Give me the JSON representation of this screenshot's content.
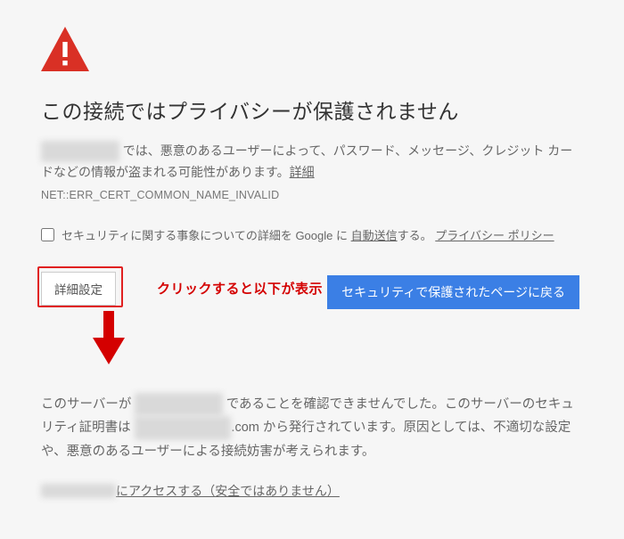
{
  "warningIcon": "triangle-exclamation",
  "title": "この接続ではプライバシーが保護されません",
  "bodyLine1_prefix": "",
  "bodyLine1_suffix": " では、悪意のあるユーザーによって、パスワード、メッセージ、クレジット カードなどの情報が盗まれる可能性があります。",
  "learnMore": "詳細",
  "errorCode": "NET::ERR_CERT_COMMON_NAME_INVALID",
  "optin_prefix": "セキュリティに関する事象についての詳細を Google に",
  "optin_link1": "自動送信",
  "optin_mid": "する。",
  "optin_link2": "プライバシー ポリシー",
  "advancedBtn": "詳細設定",
  "annotation": "クリックすると以下が表示",
  "backBtn": "セキュリティで保護されたページに戻る",
  "details_p1_a": "このサーバーが ",
  "details_p1_b": " であることを確認できませんでした。このサーバーのセキュリティ証明書は ",
  "details_p1_c": ".com から発行されています。原因としては、不適切な設定や、悪意のあるユーザーによる接続妨害が考えられます。",
  "proceed_mid": "にアクセスする（安全ではありません）",
  "redact_dom1": "xxx xxxxxxxxx",
  "redact_dom2": "xxx xxxxxxxxxx",
  "redact_dom3": "xxxxxxxxxxxxxxx",
  "redact_dom4": "xxxxxxxxxxxx "
}
